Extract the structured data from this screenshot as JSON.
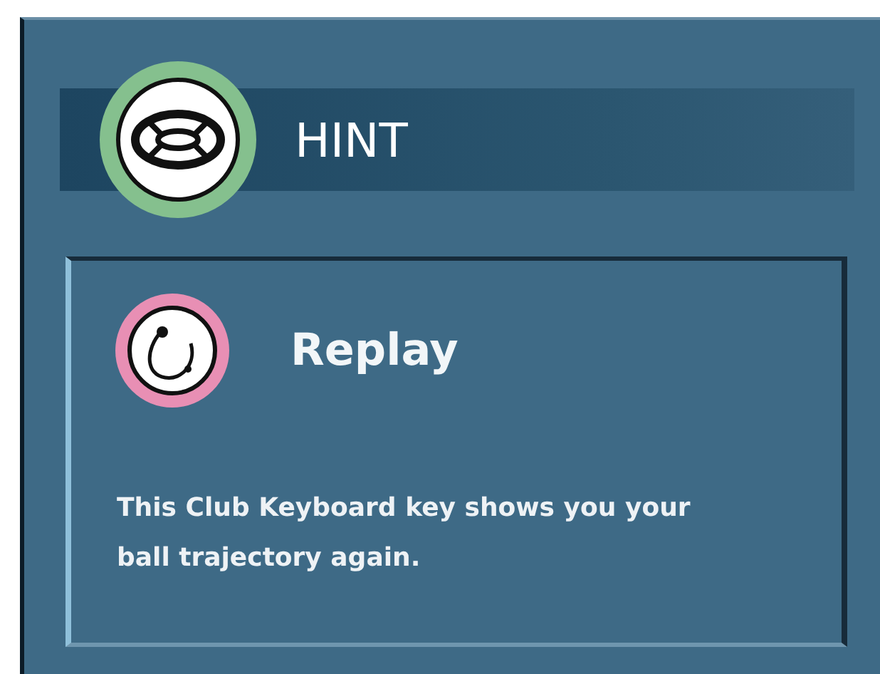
{
  "header": {
    "title": "HINT"
  },
  "hint": {
    "title": "Replay",
    "text": "This Club Keyboard key shows you your ball trajectory again."
  }
}
